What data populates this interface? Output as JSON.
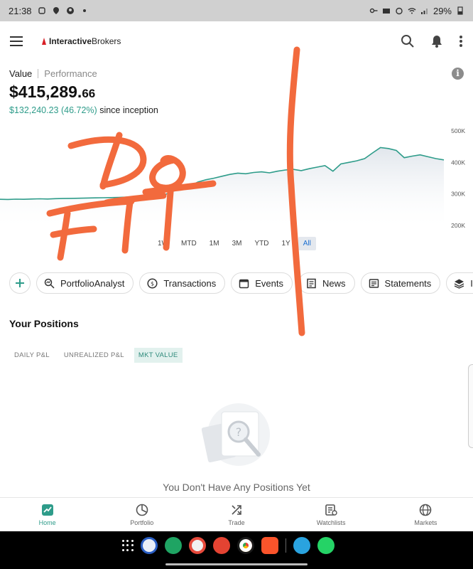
{
  "status_bar": {
    "time": "21:38",
    "battery": "29%"
  },
  "header": {
    "brand_bold": "Interactive",
    "brand_regular": "Brokers"
  },
  "value_tabs": {
    "active": "Value",
    "inactive": "Performance"
  },
  "balance": {
    "main": "$415,289.",
    "cents": "66"
  },
  "gain": {
    "value": "$132,240.23 (46.72%)",
    "suffix": " since inception"
  },
  "chart_data": {
    "type": "line",
    "y_ticks": [
      "500K",
      "400K",
      "300K",
      "200K"
    ],
    "ylim": [
      200000,
      500000
    ],
    "range_labels": [
      "1W",
      "MTD",
      "1M",
      "3M",
      "YTD",
      "1Y",
      "All"
    ],
    "selected_range": "All",
    "line_color": "#2e9c8a",
    "series": [
      {
        "values": [
          283000,
          282500,
          283500,
          283000,
          284000,
          284500,
          284000,
          285000,
          285500,
          286000,
          286500,
          287000,
          287500,
          288000,
          288500,
          289000,
          290000,
          289500,
          290500,
          291000,
          293000,
          300000,
          310000,
          318000,
          326000,
          338000,
          345000,
          350000,
          356000,
          362000,
          366000,
          364000,
          368000,
          370000,
          367000,
          372000,
          376000,
          378000,
          374000,
          380000,
          385000,
          390000,
          372000,
          395000,
          400000,
          405000,
          412000,
          430000,
          447000,
          444000,
          438000,
          415000,
          420000,
          424000,
          418000,
          412000,
          408000
        ]
      }
    ]
  },
  "chips": [
    {
      "label": "",
      "icon": "plus-icon"
    },
    {
      "label": "PortfolioAnalyst",
      "icon": "analyst-icon"
    },
    {
      "label": "Transactions",
      "icon": "transactions-icon"
    },
    {
      "label": "Events",
      "icon": "calendar-icon"
    },
    {
      "label": "News",
      "icon": "news-icon"
    },
    {
      "label": "Statements",
      "icon": "statements-icon"
    },
    {
      "label": "IBI",
      "icon": "layers-icon"
    }
  ],
  "positions": {
    "title": "Your Positions",
    "tabs": [
      "DAILY P&L",
      "UNREALIZED P&L",
      "MKT VALUE"
    ],
    "selected_tab": "MKT VALUE",
    "empty_text": "You Don't Have Any Positions Yet"
  },
  "bottom_nav": [
    {
      "label": "Home",
      "icon": "home-chart-icon"
    },
    {
      "label": "Portfolio",
      "icon": "portfolio-icon"
    },
    {
      "label": "Trade",
      "icon": "trade-icon"
    },
    {
      "label": "Watchlists",
      "icon": "watchlist-icon"
    },
    {
      "label": "Markets",
      "icon": "globe-icon"
    }
  ],
  "accent_color": "#2e9c8a",
  "overlay": {
    "handwriting": "Do FTT",
    "color": "#f26a3d"
  }
}
